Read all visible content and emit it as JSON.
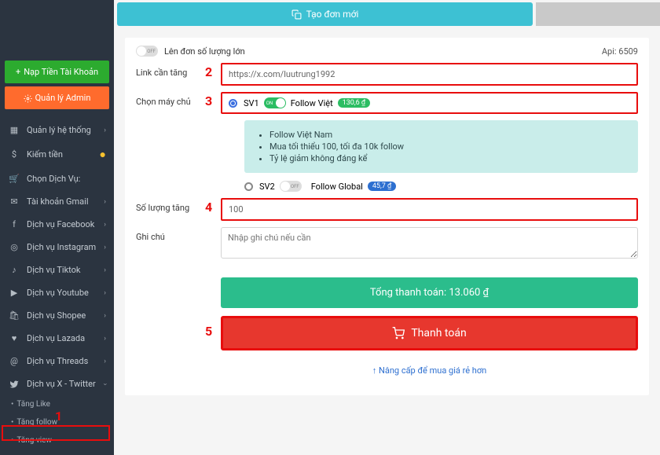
{
  "sidebar": {
    "add_funds": "Nạp Tiền Tài Khoản",
    "admin": "Quản lý Admin",
    "items": [
      {
        "icon": "grid",
        "label": "Quản lý hệ thống"
      },
      {
        "icon": "dollar",
        "label": "Kiếm tiền",
        "coin": true
      },
      {
        "icon": "cart",
        "label": "Chọn Dịch Vụ:"
      },
      {
        "icon": "mail",
        "label": "Tài khoản Gmail"
      },
      {
        "icon": "fb",
        "label": "Dịch vụ Facebook"
      },
      {
        "icon": "ig",
        "label": "Dịch vụ Instagram"
      },
      {
        "icon": "tiktok",
        "label": "Dịch vụ Tiktok"
      },
      {
        "icon": "yt",
        "label": "Dịch vụ Youtube"
      },
      {
        "icon": "bag",
        "label": "Dịch vụ Shopee"
      },
      {
        "icon": "heart",
        "label": "Dịch vụ Lazada"
      },
      {
        "icon": "at",
        "label": "Dịch vụ Threads"
      },
      {
        "icon": "bird",
        "label": "Dịch vụ X - Twitter",
        "active": true
      }
    ],
    "subs": [
      {
        "label": "Tăng Like"
      },
      {
        "label": "Tăng follow",
        "selected": true
      },
      {
        "label": "Tăng view"
      }
    ]
  },
  "topbar": {
    "new_order": "Tạo đơn mới"
  },
  "form": {
    "bulk_label": "Lên đơn số lượng lớn",
    "api_label": "Api: 6509",
    "link_label": "Link cần tăng",
    "link_value": "https://x.com/luutrung1992",
    "server_label": "Chọn máy chủ",
    "sv1": {
      "name": "SV1",
      "follow": "Follow Việt",
      "price": "130,6 ₫"
    },
    "info": [
      "Follow Việt Nam",
      "Mua tối thiểu 100, tối đa 10k follow",
      "Tỷ lệ giảm không đáng kể"
    ],
    "sv2": {
      "name": "SV2",
      "follow": "Follow Global",
      "price": "45,7 ₫"
    },
    "qty_label": "Số lượng tăng",
    "qty_value": "100",
    "note_label": "Ghi chú",
    "note_placeholder": "Nhập ghi chú nếu cần",
    "total": "Tổng thanh toán: 13.060  ₫",
    "pay": "Thanh toán",
    "upgrade": "↑ Nâng cấp để mua giá rẻ hơn"
  },
  "markers": {
    "m1": "1",
    "m2": "2",
    "m3": "3",
    "m4": "4",
    "m5": "5"
  }
}
